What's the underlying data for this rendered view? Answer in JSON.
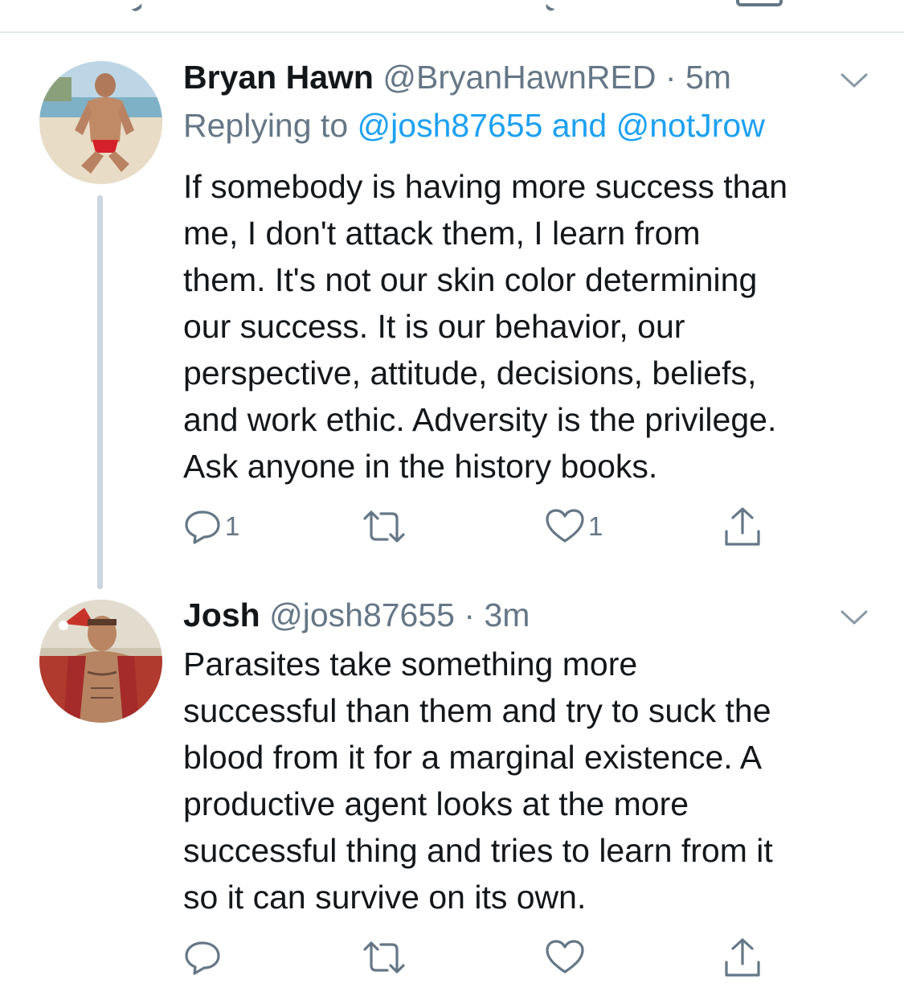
{
  "tweets": [
    {
      "name": "Bryan Hawn",
      "handle": "@BryanHawnRED",
      "separator": "·",
      "time": "5m",
      "reply_prefix": "Replying to",
      "reply_user1": "@josh87655",
      "reply_and": "and",
      "reply_user2": "@notJrow",
      "text": "If somebody is having more success than\nme, I don't attack them, I learn from\nthem. It's not our skin color determining\nour success. It is our behavior, our\nperspective, attitude, decisions, beliefs,\nand work ethic. Adversity is the privilege.\nAsk anyone in the history books.",
      "reply_count": "1",
      "retweet_count": "",
      "like_count": "1"
    },
    {
      "name": "Josh",
      "handle": "@josh87655",
      "separator": "·",
      "time": "3m",
      "text": "Parasites take something more\nsuccessful than them and try to suck the\nblood from it for a marginal existence. A\nproductive agent looks at the more\nsuccessful thing and tries to learn from it\nso it can survive on its own.",
      "reply_count": "",
      "retweet_count": "",
      "like_count": ""
    }
  ],
  "icons": {
    "reply": "reply-icon",
    "retweet": "retweet-icon",
    "like": "heart-icon",
    "share": "share-icon",
    "more": "chevron-down-icon"
  },
  "colors": {
    "text": "#14171a",
    "secondary": "#657786",
    "link": "#1da1f2",
    "thread_line": "#cbd6de",
    "divider": "#e1e8ed"
  }
}
